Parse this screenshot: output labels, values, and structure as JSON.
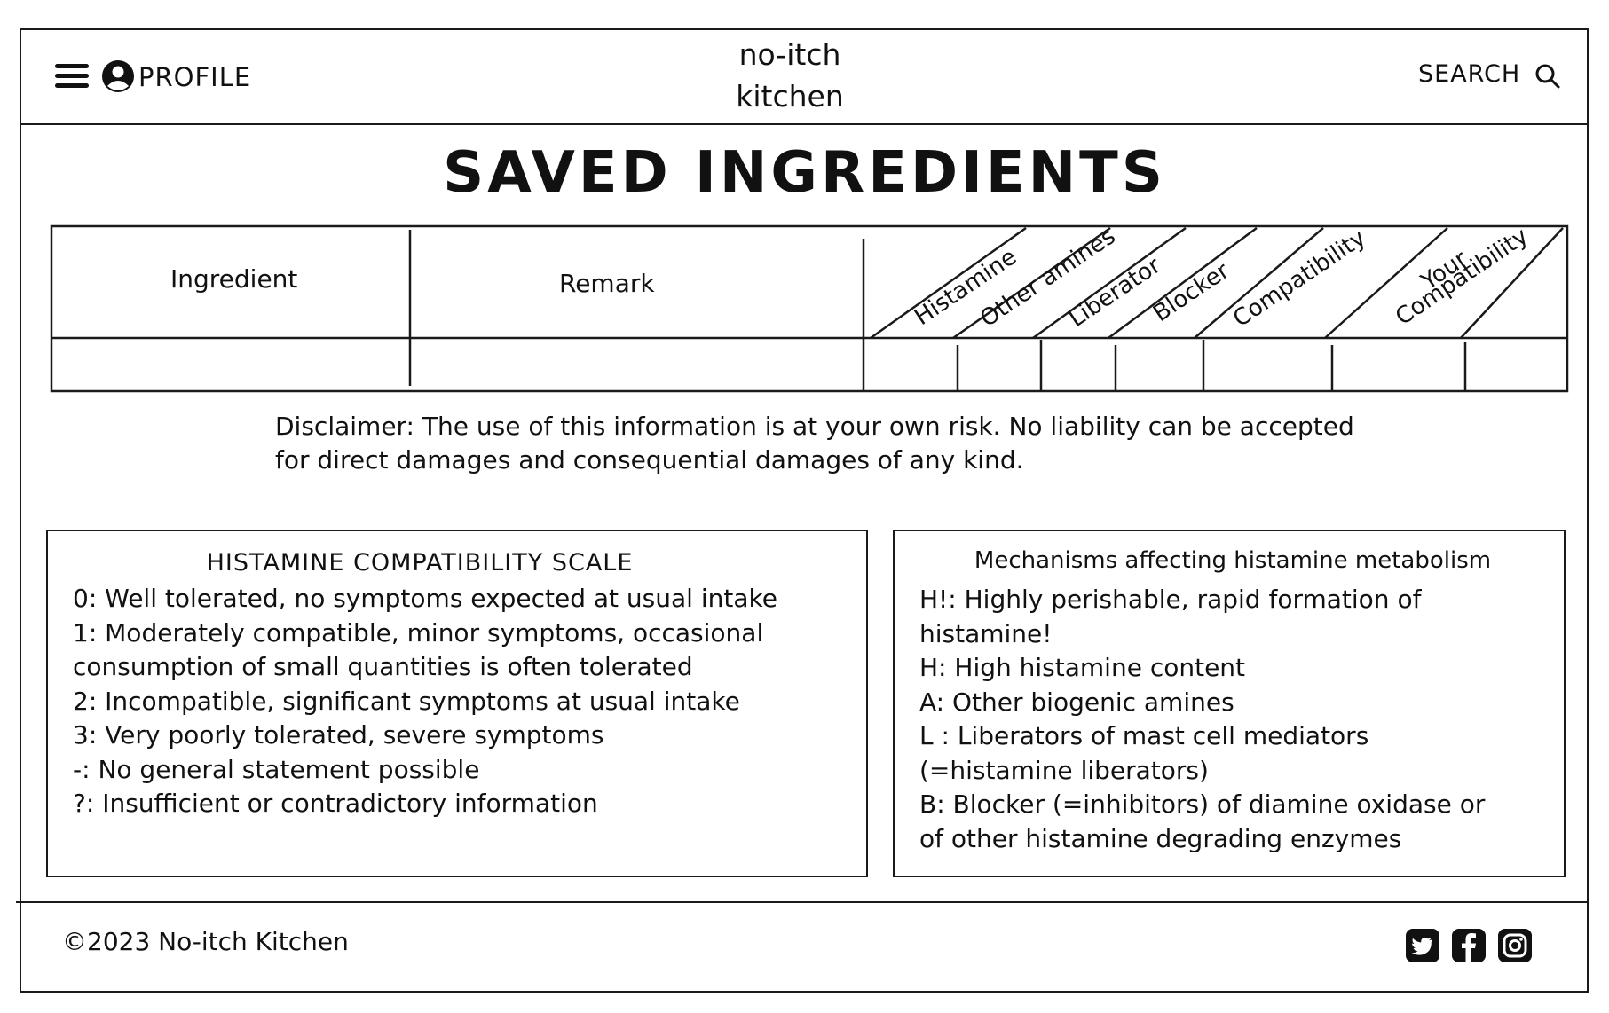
{
  "header": {
    "profile_label": "PROFILE",
    "logo_line1": "no-itch",
    "logo_line2": "kitchen",
    "search_label": "SEARCH"
  },
  "page_title": "SAVED INGREDIENTS",
  "table": {
    "col_ingredient": "Ingredient",
    "col_remark": "Remark",
    "col_histamine": "Histamine",
    "col_other_amines": "Other amines",
    "col_liberator": "Liberator",
    "col_blocker": "Blocker",
    "col_compatibility": "Compatibility",
    "col_your_line1": "Your",
    "col_your_line2": "Compatibility"
  },
  "disclaimer": "Disclaimer: The use of this information is at your own risk. No liability can be accepted for direct damages and consequential damages of any kind.",
  "scale_box": {
    "title": "HISTAMINE COMPATIBILITY SCALE",
    "items": [
      "0: Well tolerated, no symptoms expected at usual intake",
      "1: Moderately compatible, minor symptoms, occasional consumption of small quantities is often tolerated",
      "2: Incompatible, significant symptoms at usual intake",
      "3: Very poorly tolerated, severe symptoms",
      "-: No general statement possible",
      "?: Insufficient or contradictory information"
    ]
  },
  "mech_box": {
    "title": "Mechanisms affecting histamine metabolism",
    "items": [
      "H!: Highly perishable, rapid formation of histamine!",
      "H: High histamine content",
      "A: Other biogenic amines",
      "L : Liberators of mast cell mediators (=histamine liberators)",
      "B: Blocker (=inhibitors) of diamine oxidase or of other histamine degrading enzymes"
    ]
  },
  "footer": {
    "copyright": "©2023 No-itch Kitchen"
  },
  "icons": [
    "menu-icon",
    "profile-icon",
    "search-icon",
    "twitter-icon",
    "facebook-icon",
    "instagram-icon"
  ]
}
